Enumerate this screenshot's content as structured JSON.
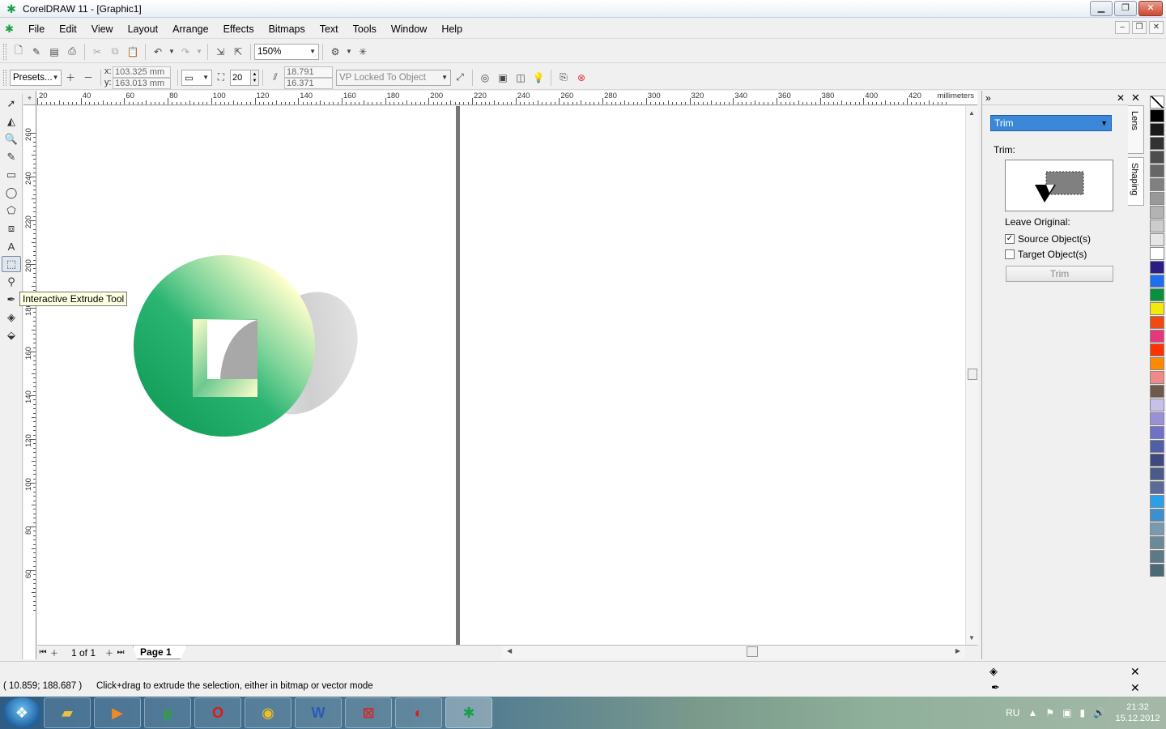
{
  "window": {
    "title": "CorelDRAW 11 - [Graphic1]",
    "minimize": "▁",
    "restore": "❐",
    "close": "✕"
  },
  "menu": {
    "items": [
      "File",
      "Edit",
      "View",
      "Layout",
      "Arrange",
      "Effects",
      "Bitmaps",
      "Text",
      "Tools",
      "Window",
      "Help"
    ],
    "mdi_minimize": "–",
    "mdi_restore": "❐",
    "mdi_close": "✕"
  },
  "standard_toolbar": {
    "zoom_level": "150%"
  },
  "property_bar": {
    "presets": "Presets...",
    "x_label": "x:",
    "x_value": "103.325 mm",
    "y_label": "y:",
    "y_value": "163.013 mm",
    "depth_value": "20",
    "vp_x_value": "18.791",
    "vp_y_value": "16.371",
    "vp_mode": "VP Locked To Object"
  },
  "toolbox": {
    "tooltip": "Interactive Extrude Tool"
  },
  "ruler": {
    "unit": "millimeters",
    "h_labels": [
      "20",
      "40",
      "60",
      "80",
      "100",
      "120",
      "140",
      "160",
      "180",
      "200",
      "220",
      "240",
      "260",
      "280",
      "300",
      "320",
      "340",
      "360",
      "380",
      "400",
      "420"
    ],
    "v_labels": [
      "260",
      "240",
      "220",
      "200",
      "180",
      "160",
      "140",
      "120",
      "100",
      "80",
      "60"
    ]
  },
  "page_nav": {
    "count": "1 of 1",
    "page_tab": "Page 1"
  },
  "docker": {
    "mode": "Trim",
    "section_label": "Trim:",
    "leave_original": "Leave Original:",
    "source_objects": "Source Object(s)",
    "source_checked": true,
    "target_objects": "Target Object(s)",
    "target_checked": false,
    "action_button": "Trim",
    "tabs": [
      "Lens",
      "Shaping"
    ]
  },
  "palette": {
    "colors": [
      "#000000",
      "#1a1a1a",
      "#333333",
      "#4d4d4d",
      "#666666",
      "#808080",
      "#999999",
      "#b3b3b3",
      "#cccccc",
      "#e6e6e6",
      "#ffffff",
      "#2b1d84",
      "#1e6ff0",
      "#0a8f3c",
      "#f5e90a",
      "#f04a10",
      "#e8367a",
      "#ff3300",
      "#ff8a00",
      "#f08a8a",
      "#6e5a4a",
      "#c8c0e8",
      "#9a90d8",
      "#7070c8",
      "#5060a8",
      "#404880",
      "#4a5a8a",
      "#5a6a9a",
      "#2aa0e8",
      "#3a90d0",
      "#7a9ab0",
      "#6a8a98",
      "#5a7a88",
      "#4a6a78"
    ]
  },
  "status": {
    "coordinates": "( 10.859; 188.687 )",
    "message": "Click+drag to extrude the selection, either in bitmap or vector mode"
  },
  "taskbar": {
    "language": "RU",
    "time": "21:32",
    "date": "15.12.2012"
  }
}
